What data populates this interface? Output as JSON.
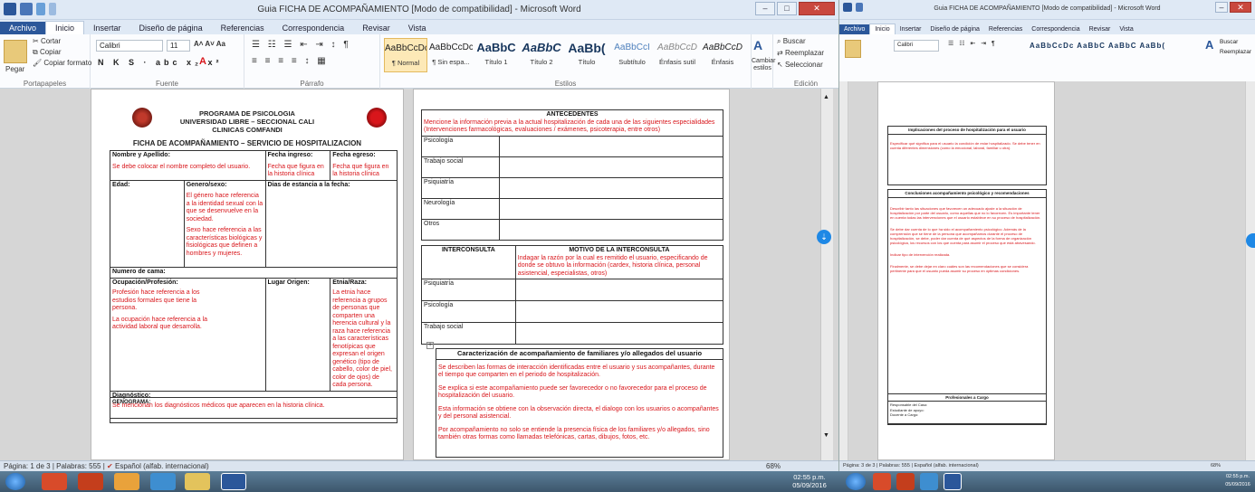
{
  "main_window": {
    "title": "Guia FICHA DE ACOMPAÑAMIENTO [Modo de compatibilidad] - Microsoft Word",
    "tabs": [
      "Archivo",
      "Inicio",
      "Insertar",
      "Diseño de página",
      "Referencias",
      "Correspondencia",
      "Revisar",
      "Vista"
    ],
    "ribbon": {
      "clipboard": {
        "paste": "Pegar",
        "cut": "Cortar",
        "copy": "Copiar",
        "format_painter": "Copiar formato",
        "label": "Portapapeles"
      },
      "font": {
        "font_name": "Calibri",
        "font_size": "11",
        "format_row": "N K S · abc x₂ x²",
        "label": "Fuente"
      },
      "paragraph": {
        "label": "Párrafo"
      },
      "styles": {
        "label": "Estilos",
        "items": [
          {
            "sample": "AaBbCcDc",
            "name": "¶ Normal"
          },
          {
            "sample": "AaBbCcDc",
            "name": "¶ Sin espa..."
          },
          {
            "sample": "AaBbC",
            "name": "Título 1"
          },
          {
            "sample": "AaBbC",
            "name": "Título 2"
          },
          {
            "sample": "AaBb(",
            "name": "Título"
          },
          {
            "sample": "AaBbCcI",
            "name": "Subtítulo"
          },
          {
            "sample": "AaBbCcD",
            "name": "Énfasis sutil"
          },
          {
            "sample": "AaBbCcD",
            "name": "Énfasis"
          }
        ],
        "change_styles": "Cambiar estilos"
      },
      "editing": {
        "find": "Buscar",
        "replace": "Reemplazar",
        "select": "Seleccionar",
        "label": "Edición"
      }
    },
    "statusbar": {
      "page": "Página: 1 de 3",
      "words": "Palabras: 555",
      "language": "Español (alfab. internacional)",
      "zoom": "68%"
    }
  },
  "page1": {
    "header_lines": [
      "PROGRAMA DE PSICOLOGIA",
      "UNIVERSIDAD LIBRE – SECCIONAL CALI",
      "CLINICAS COMFANDI"
    ],
    "form_title": "FICHA DE ACOMPAÑAMIENTO – SERVICIO DE HOSPITALIZACION",
    "nombre_label": "Nombre y Apellido:",
    "nombre_text": "Se debe colocar el nombre completo del usuario.",
    "fecha_ingreso_label": "Fecha ingreso:",
    "fecha_ingreso_text": "Fecha que figura en la historia clínica",
    "fecha_egreso_label": "Fecha egreso:",
    "fecha_egreso_text": "Fecha que figura en la historia clínica",
    "edad_label": "Edad:",
    "genero_label": "Genero/sexo:",
    "genero_text1": "El género hace referencia a la identidad sexual con la que se desenvuelve en la sociedad.",
    "genero_text2": "Sexo hace referencia a las características biológicas y fisiológicas que definen a hombres y mujeres.",
    "dias_label": "Dias de estancia a la fecha:",
    "cama_label": "Numero de cama:",
    "ocupacion_label": "Ocupación/Profesión:",
    "ocupacion_text1": "Profesión hace referencia a los estudios formales que tiene la persona.",
    "ocupacion_text2": "La ocupación hace referencia a la actividad laboral que desarrolla.",
    "lugar_label": "Lugar Origen:",
    "etnia_label": "Etnia/Raza:",
    "etnia_text": "La etnia hace referencia a grupos de personas que comparten una herencia cultural y la raza hace referencia a las características fenotípicas que expresan el origen genético (tipo de cabello, color de piel, color de ojos) de cada persona.",
    "diagnostico_label": "Diagnóstico:",
    "diagnostico_text": "Se mencionan los diagnósticos médicos que aparecen en la historia clínica.",
    "genograma_label": "GENOGRAMA:"
  },
  "page2": {
    "antecedentes_title": "ANTECEDENTES",
    "antecedentes_text": "Mencione la información previa a la actual hospitalización de cada una de las siguientes especialidades (Intervenciones farmacológicas, evaluaciones / exámenes, psicoterapia, entre otros)",
    "antecedentes_rows": [
      "Psicología",
      "Trabajo social",
      "Psiquiatría",
      "Neurología",
      "Otros"
    ],
    "interconsulta_title": "INTERCONSULTA",
    "motivo_title": "MOTIVO DE LA INTERCONSULTA",
    "motivo_text": "Indagar la razón por la cual es remitido el usuario, especificando de donde se obtuvo la información (cardex, historia clínica, personal asistencial, especialistas, otros)",
    "interconsulta_rows": [
      "Psiquiatría",
      "Psicología",
      "Trabajo social"
    ],
    "caracterizacion_title": "Caracterización de acompañamiento de familiares y/o allegados del usuario",
    "caracterizacion_paragraphs": [
      "Se describen las formas de interacción identificadas entre el usuario y sus acompañantes, durante el tiempo que comparten en el periodo de hospitalización.",
      "Se explica si este acompañamiento puede ser favorecedor o no favorecedor para el proceso de hospitalización del usuario.",
      "Esta información se obtiene con la observación directa, el dialogo con los usuarios o acompañantes y del personal asistencial.",
      "Por acompañamiento no solo se entiende la presencia física de los familiares y/o allegados, sino también otras formas como llamadas telefónicas, cartas, dibujos, fotos, etc."
    ]
  },
  "right_window": {
    "title": "Guia FICHA DE ACOMPAÑAMIENTO [Modo de compatibilidad] - Microsoft Word",
    "tabs": [
      "Archivo",
      "Inicio",
      "Insertar",
      "Diseño de página",
      "Referencias",
      "Correspondencia",
      "Revisar",
      "Vista"
    ],
    "page": {
      "implicaciones_title": "Implicaciones del proceso de hospitalización para el usuario",
      "implicaciones_text": "Especificar qué significa para el usuario la condición de estar hospitalizado. Se debe tener en cuenta diferentes dimensiones (como la emocional, laboral, familiar u otra).",
      "conclusiones_title": "Conclusiones acompañamiento psicológico y recomendaciones",
      "conclusiones_text": "Describir tanto las situaciones que favorecen un adecuado ajuste a la situación de hospitalización por parte del usuario, como aquellas que no lo favorecen. Es importante tener en cuenta todas las intervenciones que el usuario establece en su proceso de hospitalización.",
      "conclusiones_text2": "Se debe dar cuenta de lo que ha sido el acompañamiento psicológico. Además de la comprensión que se tiene de la persona que acompañamos durante el proceso de hospitalización, se debe, poder dar cuenta de qué aspectos de la forma de organización psicológica, los recursos con los que cuenta para asumir el proceso que está atravesando.",
      "conclusiones_text3": "Indicar tipo de intervención realizada.",
      "conclusiones_text4": "Finalmente, se debe dejar en claro cuáles son las recomendaciones que se considera pertinente para que el usuario pueda asumir su proceso en óptimas condiciones.",
      "profesionales_title": "Profesionales a Cargo",
      "profesionales_rows": [
        "Responsable del Caso:",
        "Estudiante de apoyo:",
        "Docente a Cargo:"
      ]
    },
    "statusbar": {
      "page": "Página: 3 de 3",
      "words": "Palabras: 555",
      "language": "Español (alfab. internacional)",
      "zoom": "68%"
    }
  },
  "taskbar": {
    "clock_main": {
      "time": "02:55 p.m.",
      "date": "05/09/2016"
    },
    "clock_right": {
      "time": "02:55 p.m.",
      "date": "05/09/2016"
    }
  },
  "colors": {
    "word_blue": "#2b579a",
    "annotation_red": "#d8161b",
    "ribbon_bg": "#dfe9f5"
  }
}
